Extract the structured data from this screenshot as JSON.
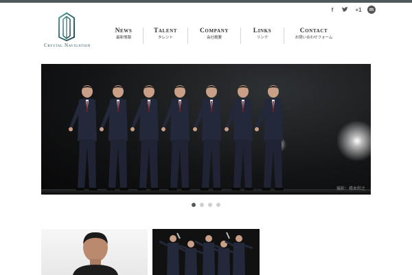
{
  "header": {
    "logo_text": "Crystal Navigation"
  },
  "social": [
    {
      "icon": "facebook-icon",
      "label": "f"
    },
    {
      "icon": "twitter-icon",
      "label": "t"
    },
    {
      "icon": "google-plus-icon",
      "label": "+1"
    },
    {
      "icon": "share-icon",
      "label": "m"
    }
  ],
  "nav": [
    {
      "en": "News",
      "jp": "最新情報"
    },
    {
      "en": "Talent",
      "jp": "タレント"
    },
    {
      "en": "Company",
      "jp": "会社概要"
    },
    {
      "en": "Links",
      "jp": "リンク"
    },
    {
      "en": "Contact",
      "jp": "お問い合わせフォーム"
    }
  ],
  "hero": {
    "credit": "撮影：橋本和之",
    "slide_count": 4,
    "active_slide": 1
  },
  "colors": {
    "accent": "#4f5a5c",
    "logo": "#2f6b6e"
  }
}
